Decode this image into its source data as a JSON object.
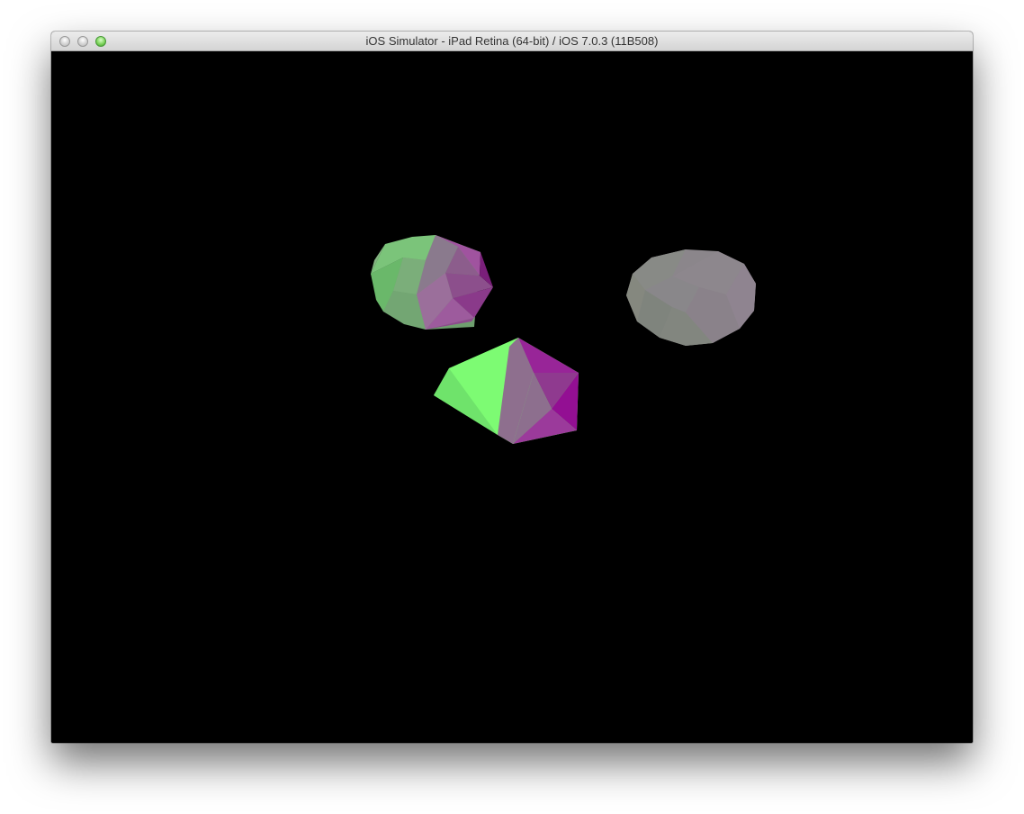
{
  "window": {
    "title": "iOS Simulator - iPad Retina (64-bit) / iOS 7.0.3 (11B508)",
    "controls": [
      "close",
      "minimize",
      "zoom"
    ]
  },
  "scene": {
    "background_color": "#000000",
    "objects": [
      {
        "name": "polyhedron-green-magenta-left",
        "colors": [
          "#7ccf7a",
          "#9b3f9b"
        ]
      },
      {
        "name": "polyhedron-green-magenta-center",
        "colors": [
          "#7dfb73",
          "#930f93"
        ]
      },
      {
        "name": "sphere-grey-right",
        "colors": [
          "#8b868b"
        ]
      }
    ]
  }
}
